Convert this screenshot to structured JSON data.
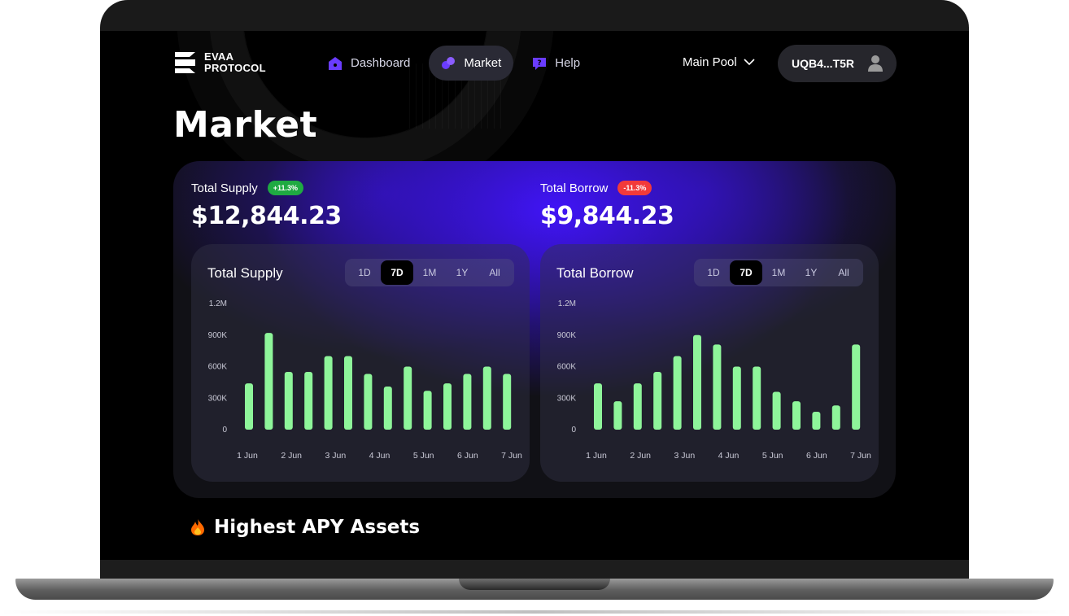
{
  "header": {
    "logo_line1": "EVAA",
    "logo_line2": "PROTOCOL",
    "nav": [
      {
        "label": "Dashboard",
        "icon": "home-icon",
        "active": false
      },
      {
        "label": "Market",
        "icon": "market-icon",
        "active": true
      },
      {
        "label": "Help",
        "icon": "help-icon",
        "active": false
      }
    ],
    "pool_label": "Main Pool",
    "wallet_address": "UQB4...T5R"
  },
  "page_title": "Market",
  "stats": {
    "supply": {
      "label": "Total Supply",
      "change": "+11.3%",
      "value": "$12,844.23"
    },
    "borrow": {
      "label": "Total Borrow",
      "change": "-11.3%",
      "value": "$9,844.23"
    }
  },
  "ranges": [
    "1D",
    "7D",
    "1M",
    "1Y",
    "All"
  ],
  "selected_range": "7D",
  "section_title": "Highest APY Assets",
  "colors": {
    "accent": "#4a1cff",
    "bar": "#8ef59a",
    "up": "#1faa42",
    "down": "#f23a3a"
  },
  "chart_data": [
    {
      "type": "bar",
      "title": "Total Supply",
      "y_ticks": [
        "0",
        "300K",
        "600K",
        "900K",
        "1.2M"
      ],
      "ylim": [
        0,
        1200000
      ],
      "x_labels": [
        "1 Jun",
        "2 Jun",
        "3 Jun",
        "4 Jun",
        "5 Jun",
        "6 Jun",
        "7 Jun"
      ],
      "values": [
        440000,
        920000,
        550000,
        550000,
        700000,
        700000,
        530000,
        410000,
        600000,
        370000,
        440000,
        530000,
        600000,
        530000
      ]
    },
    {
      "type": "bar",
      "title": "Total Borrow",
      "y_ticks": [
        "0",
        "300K",
        "600K",
        "900K",
        "1.2M"
      ],
      "ylim": [
        0,
        1200000
      ],
      "x_labels": [
        "1 Jun",
        "2 Jun",
        "3 Jun",
        "4 Jun",
        "5 Jun",
        "6 Jun",
        "7 Jun"
      ],
      "values": [
        440000,
        270000,
        440000,
        550000,
        700000,
        900000,
        810000,
        600000,
        600000,
        360000,
        270000,
        170000,
        230000,
        810000
      ]
    }
  ]
}
